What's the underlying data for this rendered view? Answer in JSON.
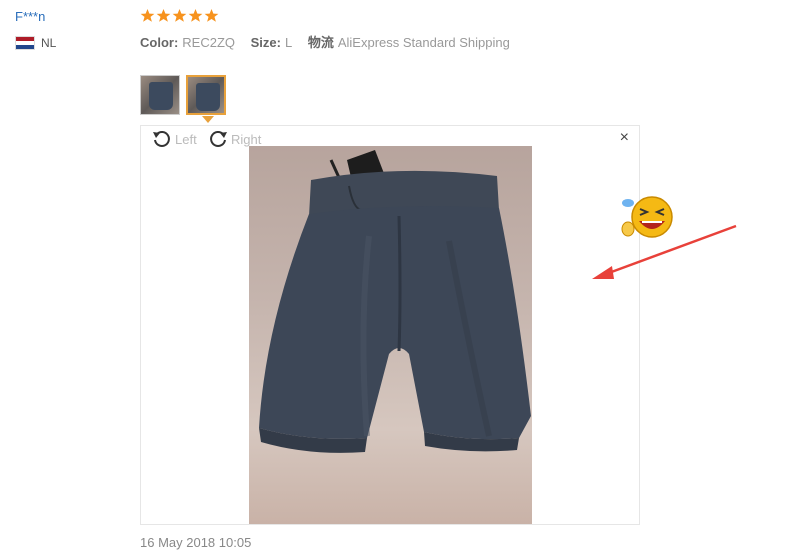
{
  "reviewer": {
    "name": "F***n",
    "country": "NL",
    "flag_colors": [
      "#ae1c28",
      "#ffffff",
      "#21468b"
    ]
  },
  "review": {
    "rating": 5,
    "max_rating": 5,
    "star_color": "#f7931e",
    "attributes": [
      {
        "key": "Color:",
        "value": "REC2ZQ"
      },
      {
        "key": "Size:",
        "value": "L"
      },
      {
        "key": "物流",
        "value": "AliExpress Standard Shipping"
      }
    ],
    "thumbnails": [
      {
        "icon": "shorts-photo-thumbnail",
        "active": false
      },
      {
        "icon": "shorts-photo-thumbnail",
        "active": true
      }
    ],
    "timestamp": "16 May 2018 10:05"
  },
  "viewer": {
    "rotate_left_label": "Left",
    "rotate_right_label": "Right",
    "close_label": "×",
    "image": "dark-grey-shorts-photo"
  },
  "colors": {
    "accent": "#e8a13b",
    "link": "#2a6ebb",
    "annotation_arrow": "#e8413a"
  }
}
